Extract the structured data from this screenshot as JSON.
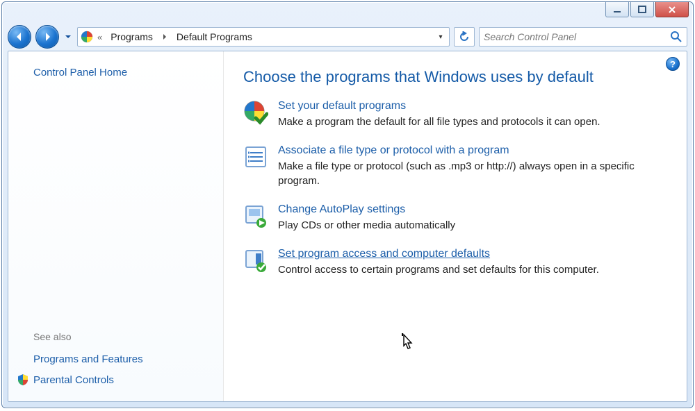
{
  "breadcrumb": {
    "parent": "Programs",
    "current": "Default Programs"
  },
  "search": {
    "placeholder": "Search Control Panel"
  },
  "sidebar": {
    "home": "Control Panel Home",
    "see_also_header": "See also",
    "links": [
      {
        "label": "Programs and Features",
        "shield": false
      },
      {
        "label": "Parental Controls",
        "shield": true
      }
    ]
  },
  "main": {
    "heading": "Choose the programs that Windows uses by default",
    "options": [
      {
        "icon": "programs-check-icon",
        "link": "Set your default programs",
        "desc": "Make a program the default for all file types and protocols it can open.",
        "underline": false
      },
      {
        "icon": "list-icon",
        "link": "Associate a file type or protocol with a program",
        "desc": "Make a file type or protocol (such as .mp3 or http://) always open in a specific program.",
        "underline": false
      },
      {
        "icon": "autoplay-icon",
        "link": "Change AutoPlay settings",
        "desc": "Play CDs or other media automatically",
        "underline": false
      },
      {
        "icon": "program-access-icon",
        "link": "Set program access and computer defaults",
        "desc": "Control access to certain programs and set defaults for this computer.",
        "underline": true
      }
    ]
  },
  "help_glyph": "?"
}
